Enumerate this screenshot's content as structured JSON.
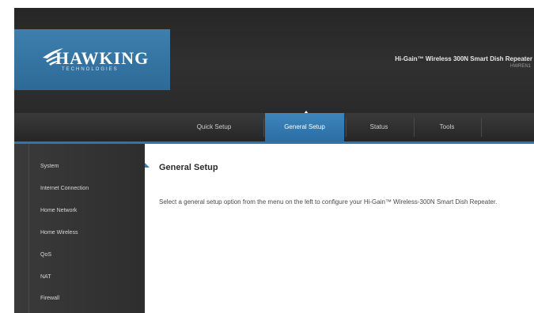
{
  "header": {
    "logo_text": "HAWKING",
    "logo_sub": "TECHNOLOGIES",
    "product_name": "Hi-Gain™ Wireless 300N Smart Dish Repeater",
    "model_number": "HWREN1"
  },
  "nav": {
    "tabs": [
      {
        "label": "Quick Setup"
      },
      {
        "label": "General Setup",
        "active": true
      },
      {
        "label": "Status"
      },
      {
        "label": "Tools"
      }
    ]
  },
  "sidebar": {
    "items": [
      {
        "label": "System"
      },
      {
        "label": "Internet Connection"
      },
      {
        "label": "Home Network"
      },
      {
        "label": "Home Wireless"
      },
      {
        "label": "QoS"
      },
      {
        "label": "NAT"
      },
      {
        "label": "Firewall"
      }
    ]
  },
  "main": {
    "title": "General Setup",
    "description": "Select a general setup option from the menu on the left to configure your Hi-Gain™ Wireless-300N Smart Dish Repeater."
  },
  "colors": {
    "accent_blue": "#2f74ab",
    "header_dark": "#2a2a2a",
    "sidebar_dark": "#333333"
  }
}
